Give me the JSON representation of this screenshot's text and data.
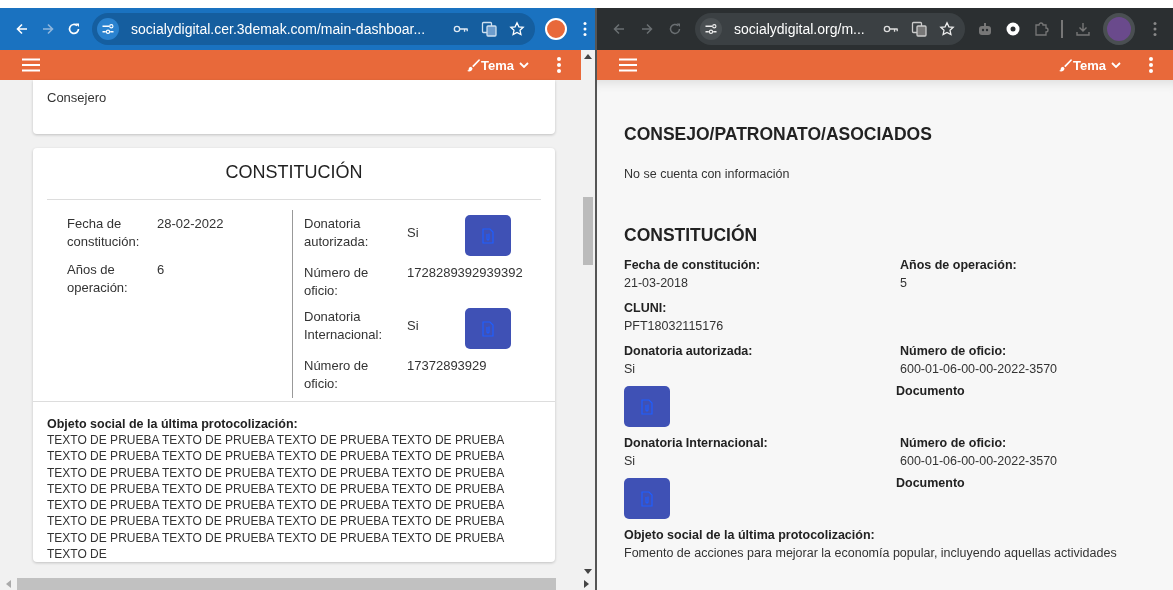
{
  "left_window": {
    "browser": {
      "url": "socialydigital.cer.3demak.com/main-dashboar..."
    },
    "app_bar": {
      "theme_label": "Tema"
    },
    "member_card": {
      "value": "Consejero"
    },
    "constitution": {
      "title": "CONSTITUCIÓN",
      "general_fields": [
        {
          "label": "Fecha de constitución:",
          "value": "28-02-2022"
        },
        {
          "label": "Años de operación:",
          "value": "6"
        }
      ],
      "donation_fields": [
        {
          "kind": "document",
          "label": "Donatoria autorizada:",
          "value": "Si"
        },
        {
          "kind": "text",
          "label": "Número de oficio:",
          "value": "1728289392939392"
        },
        {
          "kind": "document",
          "label": "Donatoria Internacional:",
          "value": "Si"
        },
        {
          "kind": "text",
          "label": "Número de oficio:",
          "value": "17372893929"
        }
      ],
      "social_object": {
        "label": "Objeto social de la última protocolización:",
        "text": "TEXTO DE PRUEBA TEXTO DE PRUEBA TEXTO DE PRUEBA TEXTO DE PRUEBA TEXTO DE PRUEBA TEXTO DE PRUEBA TEXTO DE PRUEBA TEXTO DE PRUEBA TEXTO DE PRUEBA TEXTO DE PRUEBA TEXTO DE PRUEBA TEXTO DE PRUEBA TEXTO DE PRUEBA TEXTO DE PRUEBA TEXTO DE PRUEBA TEXTO DE PRUEBA TEXTO DE PRUEBA TEXTO DE PRUEBA TEXTO DE PRUEBA TEXTO DE PRUEBA TEXTO DE PRUEBA TEXTO DE PRUEBA TEXTO DE PRUEBA TEXTO DE PRUEBA TEXTO DE PRUEBA TEXTO DE PRUEBA TEXTO DE PRUEBA TEXTO DE PRUEBA TEXTO DE"
      }
    }
  },
  "right_window": {
    "browser": {
      "url": "socialydigital.org/m..."
    },
    "app_bar": {
      "theme_label": "Tema"
    },
    "board": {
      "title": "CONSEJO/PATRONATO/ASOCIADOS",
      "message": "No se cuenta con información"
    },
    "constitution": {
      "title": "CONSTITUCIÓN",
      "rows": [
        [
          {
            "kind": "text",
            "label": "Fecha de constitución:",
            "value": "21-03-2018"
          },
          {
            "kind": "text",
            "label": "Años de operación:",
            "value": "5"
          }
        ],
        [
          {
            "kind": "text",
            "label": "CLUNI:",
            "value": "PFT18032115176"
          }
        ],
        [
          {
            "kind": "document",
            "label": "Donatoria autorizada:",
            "value": "Si"
          },
          {
            "kind": "captioned",
            "label": "Número de oficio:",
            "value": "600-01-06-00-00-2022-3570",
            "caption": "Documento"
          }
        ],
        [
          {
            "kind": "document",
            "label": "Donatoria Internacional:",
            "value": "Si"
          },
          {
            "kind": "captioned",
            "label": "Número de oficio:",
            "value": "600-01-06-00-00-2022-3570",
            "caption": "Documento"
          }
        ]
      ],
      "social_object": {
        "label": "Objeto social de la última protocolización:",
        "text": "Fomento de acciones para mejorar la economía popular, incluyendo aquellas actividades"
      }
    }
  }
}
